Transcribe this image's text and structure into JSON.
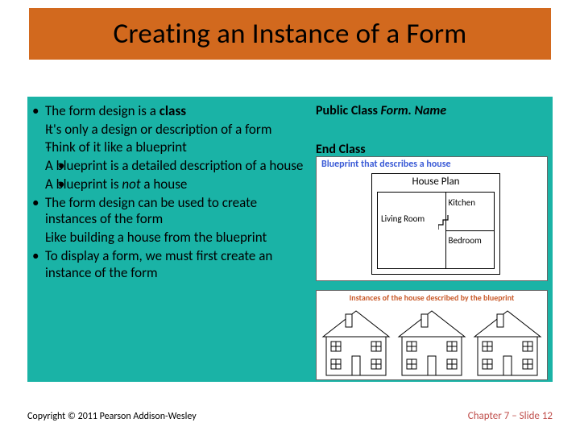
{
  "title": "Creating an Instance of a Form",
  "bullets": {
    "b1_pre": "The form design is a ",
    "b1_class": "class",
    "b1a": "It's only a design or description of a form",
    "b1b": "Think of it like a blueprint",
    "b1b_i": "A blueprint is a detailed description of a house",
    "b1b_ii_pre": "A blueprint is ",
    "b1b_ii_not": "not",
    "b1b_ii_post": " a house",
    "b2": "The form design can be used to create instances of the form",
    "b2a": "Like building a house from the blueprint",
    "b3": "To display a form, we must first create an instance of the form"
  },
  "code": {
    "line1_a": "Public Class ",
    "line1_b": "Form. Name",
    "line2": "End Class"
  },
  "diagram1": {
    "caption": "Blueprint that describes a house",
    "plan_title": "House Plan",
    "room1": "Living Room",
    "room2": "Kitchen",
    "room3": "Bedroom"
  },
  "diagram2": {
    "caption": "Instances of the house described by the blueprint"
  },
  "footer_left": "Copyright © 2011 Pearson Addison-Wesley",
  "footer_right": "Chapter 7 – Slide 12"
}
